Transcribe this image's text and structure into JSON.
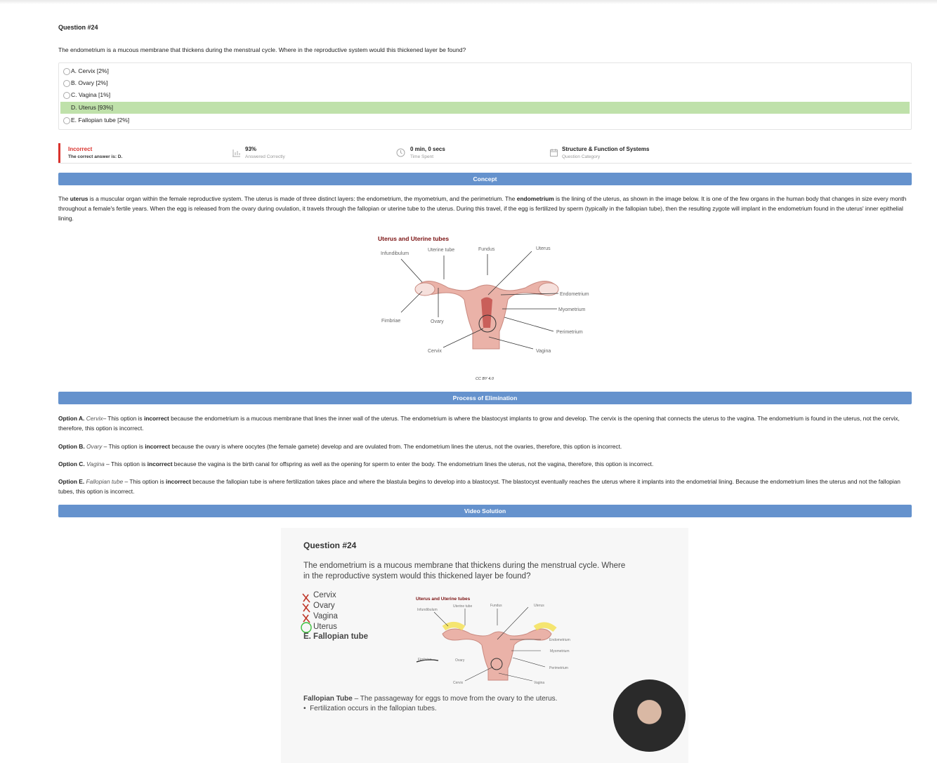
{
  "question": {
    "title": "Question #24",
    "text": "The endometrium is a mucous membrane that thickens during the menstrual cycle. Where in the reproductive system would this thickened layer be found?",
    "options": [
      {
        "label": "A. Cervix [2%]",
        "correct": false
      },
      {
        "label": "B. Ovary [2%]",
        "correct": false
      },
      {
        "label": "C. Vagina [1%]",
        "correct": false
      },
      {
        "label": "D. Uterus [93%]",
        "correct": true
      },
      {
        "label": "E. Fallopian tube [2%]",
        "correct": false
      }
    ]
  },
  "result": {
    "status": "Incorrect",
    "correct_answer": "The correct answer is: D.",
    "percent": "93%",
    "percent_label": "Answered Correctly",
    "time": "0 min, 0 secs",
    "time_label": "Time Spent",
    "category": "Structure & Function of Systems",
    "category_label": "Question Category"
  },
  "sections": {
    "concept": "Concept",
    "elimination": "Process of Elimination",
    "video": "Video Solution"
  },
  "concept": {
    "p1": "The ",
    "b1": "uterus",
    "p2": " is a muscular organ within the female reproductive system. The uterus is made of three distinct layers: the endometrium, the myometrium, and the perimetrium. The ",
    "b2": "endometrium",
    "p3": " is the lining of the uterus, as shown in the image below. It is one of the few organs in the human body that changes in size every month throughout a female's fertile years. When the egg is released from the ovary during ovulation, it travels through the fallopian or uterine tube to the uterus. During this travel, if the egg is fertilized by sperm (typically in the fallopian tube), then the resulting zygote will implant in the endometrium found in the uterus' inner epithelial lining."
  },
  "diagram": {
    "title": "Uterus and Uterine tubes",
    "labels": [
      "Infundibulum",
      "Uterine tube",
      "Fundus",
      "Uterus",
      "Endometrium",
      "Myometrium",
      "Perimetrium",
      "Fimbriae",
      "Ovary",
      "Cervix",
      "Vagina"
    ],
    "credit": "CC BY 4.0"
  },
  "elimination": [
    {
      "opt": "Option A.",
      "name": "Cervix",
      "sep": "– This option is ",
      "verdict": "incorrect",
      "rest": " because the endometrium is a mucous membrane that lines the inner wall of the uterus. The endometrium is where the blastocyst implants to grow and develop. The cervix is the opening that connects the uterus to the vagina. The endometrium is found in the uterus, not the cervix, therefore, this option is incorrect."
    },
    {
      "opt": "Option B.",
      "name": "Ovary",
      "sep": " – This option is ",
      "verdict": "incorrect",
      "rest": " because the ovary is where oocytes (the female gamete) develop and are ovulated from. The endometrium lines the uterus, not the ovaries, therefore, this option is incorrect."
    },
    {
      "opt": "Option C.",
      "name": "Vagina",
      "sep": " – This option is ",
      "verdict": "incorrect",
      "rest": " because the vagina is the birth canal for offspring as well as the opening for sperm to enter the body. The endometrium lines the uterus, not the vagina, therefore, this option is incorrect."
    },
    {
      "opt": "Option E.",
      "name": "Fallopian tube",
      "sep": " – This option is ",
      "verdict": "incorrect",
      "rest": " because the fallopian tube is where fertilization takes place and where the blastula begins to develop into a blastocyst. The blastocyst eventually reaches the uterus where it implants into the endometrial lining. Because the endometrium lines the uterus and not the fallopian tubes, this option is incorrect."
    }
  ],
  "video": {
    "title": "Question #24",
    "text": "The endometrium is a mucous membrane that thickens during the menstrual cycle. Where in the reproductive system would this thickened layer be found?",
    "options": [
      "Cervix",
      "Ovary",
      "Vagina",
      "Uterus"
    ],
    "option_e": "E. Fallopian tube",
    "footer_bold": "Fallopian Tube",
    "footer_text": " – The passageway for eggs to move from the ovary to the uterus.",
    "bullet": "Fertilization occurs in the fallopian tubes."
  },
  "colors": {
    "accent": "#6592cd",
    "correct": "#bfe1aa",
    "incorrect": "#d9322d"
  }
}
